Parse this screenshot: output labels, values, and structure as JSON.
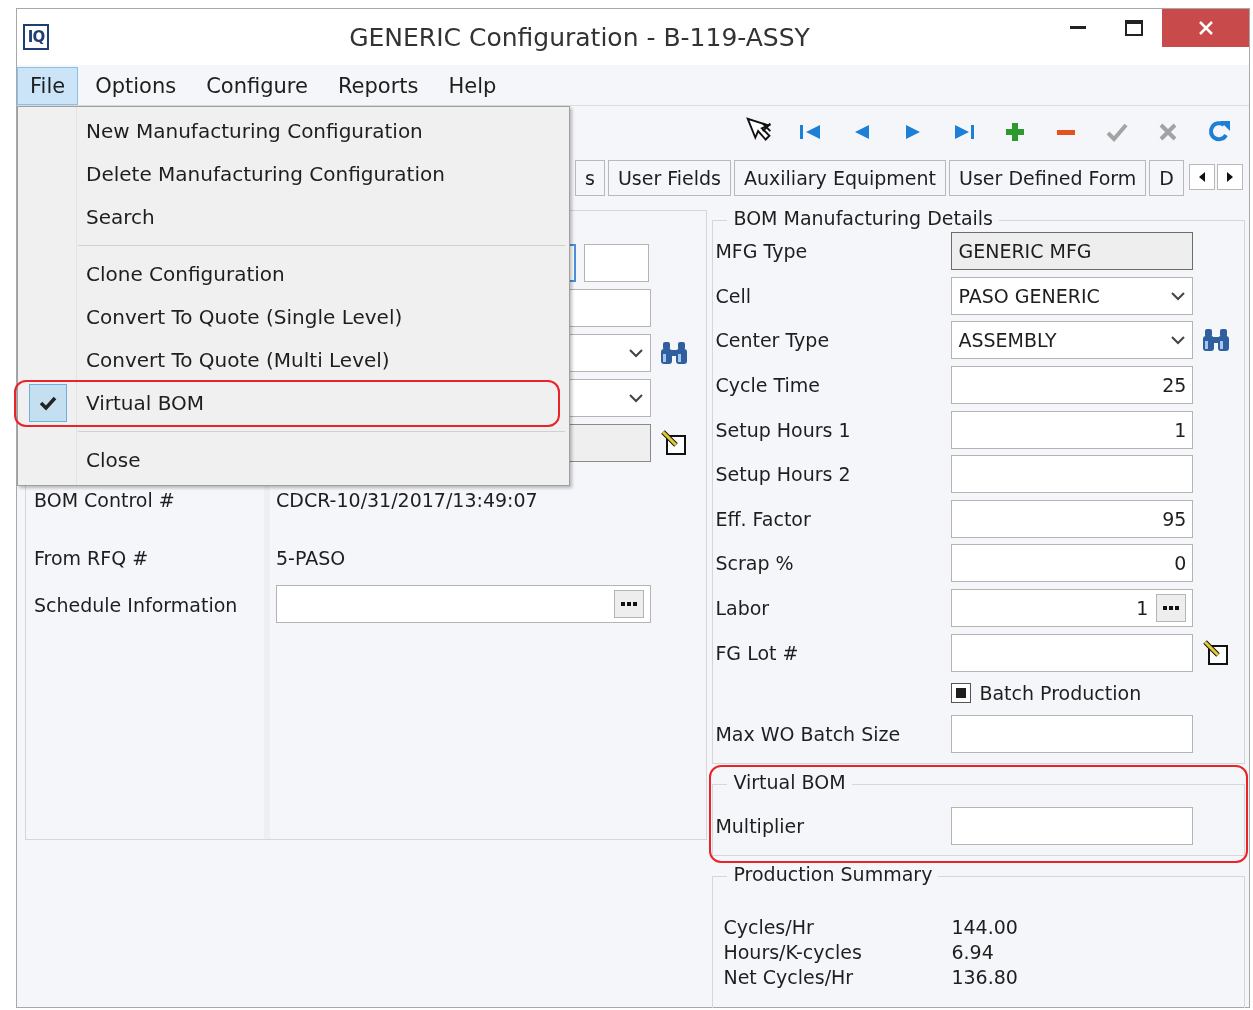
{
  "window": {
    "logo": "IQ",
    "title": "GENERIC Configuration - B-119-ASSY"
  },
  "menubar": [
    {
      "label": "File",
      "selected": true
    },
    {
      "label": "Options",
      "selected": false
    },
    {
      "label": "Configure",
      "selected": false
    },
    {
      "label": "Reports",
      "selected": false
    },
    {
      "label": "Help",
      "selected": false
    }
  ],
  "toolbar": [
    {
      "kind": "cursor"
    },
    {
      "kind": "first"
    },
    {
      "kind": "prev"
    },
    {
      "kind": "next"
    },
    {
      "kind": "last"
    },
    {
      "kind": "add"
    },
    {
      "kind": "remove"
    },
    {
      "kind": "save"
    },
    {
      "kind": "cancel"
    },
    {
      "kind": "refresh"
    }
  ],
  "tabs": [
    {
      "label": "s",
      "selected": false
    },
    {
      "label": "User Fields",
      "selected": false
    },
    {
      "label": "Auxiliary Equipment",
      "selected": false
    },
    {
      "label": "User Defined Form",
      "selected": false
    },
    {
      "label": "D",
      "selected": false
    }
  ],
  "left_panel": {
    "hidden_rows": [
      {
        "kind": "pair"
      },
      {
        "kind": "text"
      },
      {
        "kind": "select",
        "search_button": true
      },
      {
        "kind": "select"
      },
      {
        "kind": "readonly",
        "edit_button": true
      }
    ],
    "rows": [
      {
        "label": "BOM Control #",
        "kind": "static",
        "value": "CDCR-10/31/2017/13:49:07"
      },
      {
        "label": "From RFQ #",
        "kind": "static",
        "value": "5-PASO"
      },
      {
        "label": "Schedule Information",
        "kind": "browse",
        "value": ""
      }
    ]
  },
  "file_menu": [
    {
      "kind": "item",
      "label": "New Manufacturing Configuration",
      "checked": false,
      "annotated": false
    },
    {
      "kind": "item",
      "label": "Delete Manufacturing Configuration",
      "checked": false,
      "annotated": false
    },
    {
      "kind": "item",
      "label": "Search",
      "checked": false,
      "annotated": false
    },
    {
      "kind": "separator"
    },
    {
      "kind": "item",
      "label": "Clone Configuration",
      "checked": false,
      "annotated": false
    },
    {
      "kind": "item",
      "label": "Convert To Quote (Single Level)",
      "checked": false,
      "annotated": false
    },
    {
      "kind": "item",
      "label": "Convert To Quote (Multi Level)",
      "checked": false,
      "annotated": false
    },
    {
      "kind": "item",
      "label": "Virtual BOM",
      "checked": true,
      "annotated": true
    },
    {
      "kind": "separator"
    },
    {
      "kind": "item",
      "label": "Close",
      "checked": false,
      "annotated": false
    }
  ],
  "bom_details": {
    "title": "BOM Manufacturing Details",
    "rows": [
      {
        "label": "MFG Type",
        "kind": "readonly",
        "value": "GENERIC MFG"
      },
      {
        "label": "Cell",
        "kind": "select",
        "value": "PASO GENERIC"
      },
      {
        "label": "Center Type",
        "kind": "select",
        "value": "ASSEMBLY",
        "search_button": true
      },
      {
        "label": "Cycle Time",
        "kind": "number",
        "value": "25"
      },
      {
        "label": "Setup Hours 1",
        "kind": "number",
        "value": "1"
      },
      {
        "label": "Setup Hours 2",
        "kind": "number",
        "value": ""
      },
      {
        "label": "Eff. Factor",
        "kind": "number",
        "value": "95"
      },
      {
        "label": "Scrap %",
        "kind": "number",
        "value": "0"
      },
      {
        "label": "Labor",
        "kind": "number",
        "value": "1",
        "browse_button": true
      },
      {
        "label": "FG Lot #",
        "kind": "text",
        "value": "",
        "edit_button": true
      },
      {
        "label": "Batch Production",
        "kind": "checkbox",
        "checked": true
      },
      {
        "label": "Max WO Batch Size",
        "kind": "text",
        "value": ""
      }
    ]
  },
  "virtual_bom": {
    "title": "Virtual BOM",
    "annotated": true,
    "rows": [
      {
        "label": "Multiplier",
        "kind": "text",
        "value": ""
      }
    ]
  },
  "production_summary": {
    "title": "Production Summary",
    "rows": [
      {
        "label": "Cycles/Hr",
        "value": "144.00"
      },
      {
        "label": "Hours/K-cycles",
        "value": "6.94"
      },
      {
        "label": "Net Cycles/Hr",
        "value": "136.80"
      }
    ]
  }
}
